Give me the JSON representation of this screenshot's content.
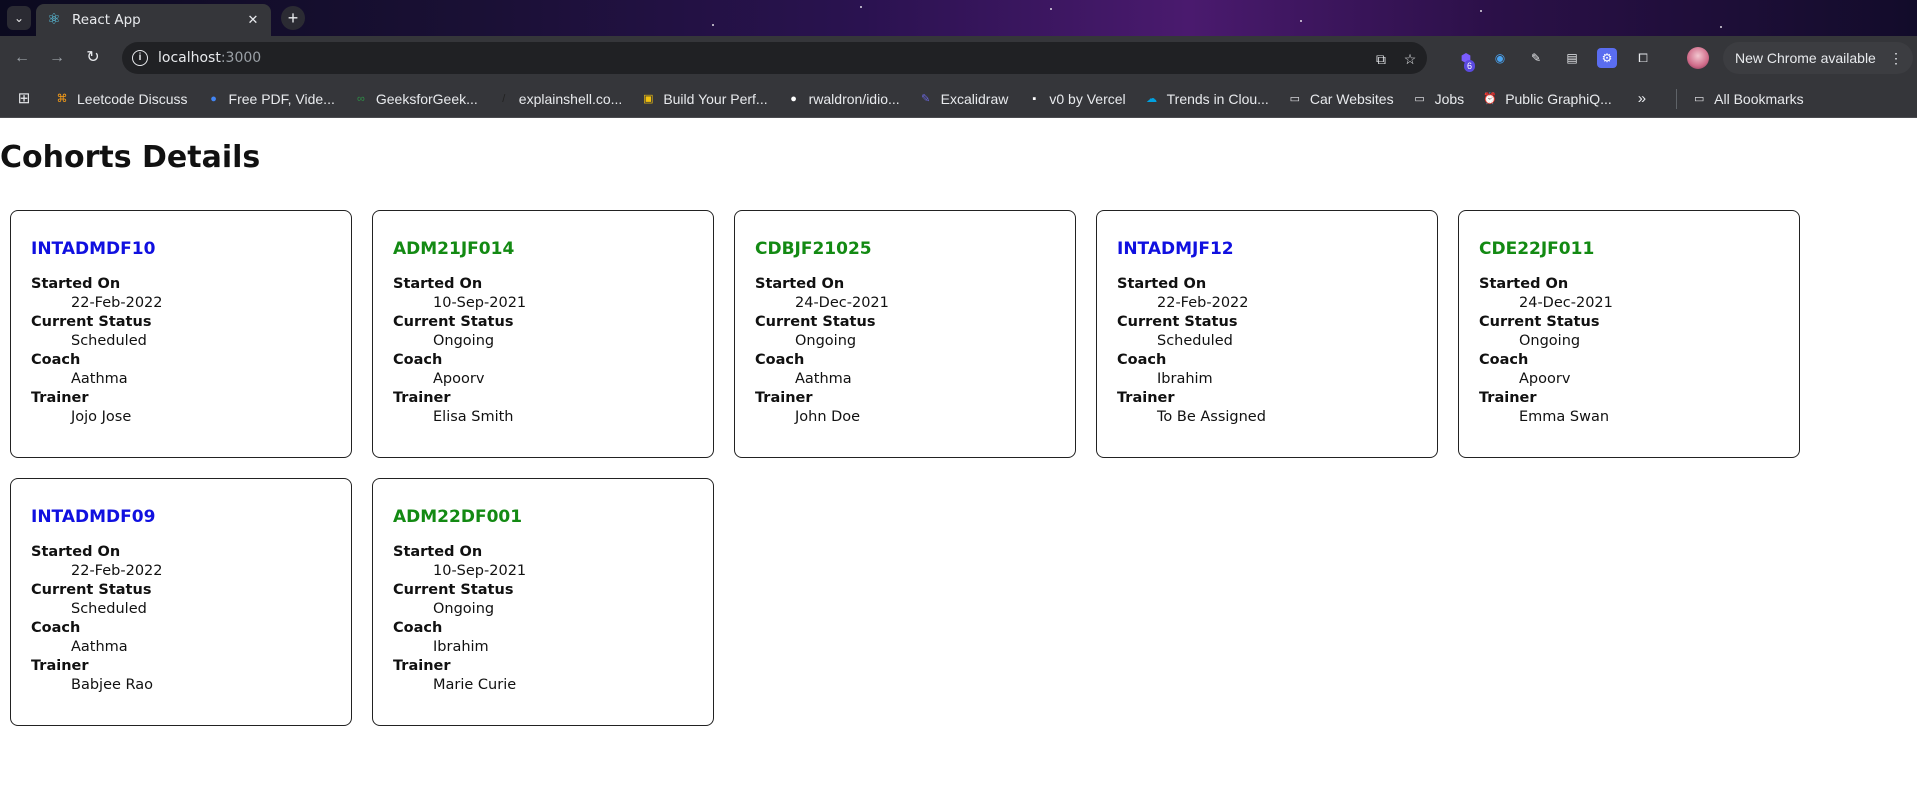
{
  "browser": {
    "tab_title": "React App",
    "url_host": "localhost",
    "url_port": ":3000",
    "extension_badge": "6",
    "update_label": "New Chrome available"
  },
  "bookmarks": [
    {
      "label": "Leetcode Discuss",
      "icon": "leetcode-icon",
      "color": "#ffa116"
    },
    {
      "label": "Free PDF, Vide...",
      "icon": "globe-icon",
      "color": "#4285f4"
    },
    {
      "label": "GeeksforGeek...",
      "icon": "gfg-icon",
      "color": "#2f8d46"
    },
    {
      "label": "explainshell.co...",
      "icon": "shell-icon",
      "color": "#222222"
    },
    {
      "label": "Build Your Perf...",
      "icon": "build-icon",
      "color": "#f4c20d"
    },
    {
      "label": "rwaldron/idio...",
      "icon": "github-icon",
      "color": "#ffffff"
    },
    {
      "label": "Excalidraw",
      "icon": "excalidraw-icon",
      "color": "#6965db"
    },
    {
      "label": "v0 by Vercel",
      "icon": "v0-icon",
      "color": "#ffffff"
    },
    {
      "label": "Trends in Clou...",
      "icon": "salesforce-icon",
      "color": "#00a1e0"
    },
    {
      "label": "Car Websites",
      "icon": "folder-icon",
      "color": "#e8eaed"
    },
    {
      "label": "Jobs",
      "icon": "folder-icon",
      "color": "#e8eaed"
    },
    {
      "label": "Public GraphiQ...",
      "icon": "clock-icon",
      "color": "#4aa3f0"
    }
  ],
  "all_bookmarks_label": "All Bookmarks",
  "page": {
    "title": "Cohorts Details",
    "labels": {
      "started_on": "Started On",
      "current_status": "Current Status",
      "coach": "Coach",
      "trainer": "Trainer"
    },
    "cohorts": [
      {
        "code": "INTADMDF10",
        "color": "blue",
        "started_on": "22-Feb-2022",
        "status": "Scheduled",
        "coach": "Aathma",
        "trainer": "Jojo Jose"
      },
      {
        "code": "ADM21JF014",
        "color": "green",
        "started_on": "10-Sep-2021",
        "status": "Ongoing",
        "coach": "Apoorv",
        "trainer": "Elisa Smith"
      },
      {
        "code": "CDBJF21025",
        "color": "green",
        "started_on": "24-Dec-2021",
        "status": "Ongoing",
        "coach": "Aathma",
        "trainer": "John Doe"
      },
      {
        "code": "INTADMJF12",
        "color": "blue",
        "started_on": "22-Feb-2022",
        "status": "Scheduled",
        "coach": "Ibrahim",
        "trainer": "To Be Assigned"
      },
      {
        "code": "CDE22JF011",
        "color": "green",
        "started_on": "24-Dec-2021",
        "status": "Ongoing",
        "coach": "Apoorv",
        "trainer": "Emma Swan"
      },
      {
        "code": "INTADMDF09",
        "color": "blue",
        "started_on": "22-Feb-2022",
        "status": "Scheduled",
        "coach": "Aathma",
        "trainer": "Babjee Rao"
      },
      {
        "code": "ADM22DF001",
        "color": "green",
        "started_on": "10-Sep-2021",
        "status": "Ongoing",
        "coach": "Ibrahim",
        "trainer": "Marie Curie"
      }
    ]
  }
}
